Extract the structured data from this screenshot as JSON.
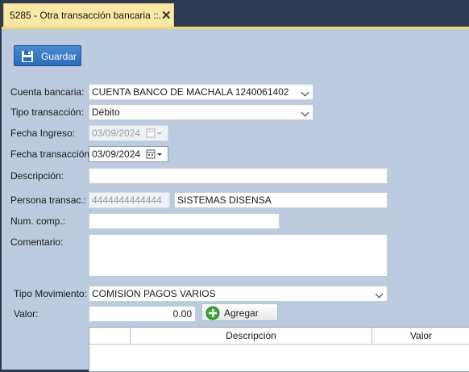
{
  "tab": {
    "title": "5285 - Otra transacción bancaria ::.",
    "close": "✕"
  },
  "toolbar": {
    "save_label": "Guardar"
  },
  "form": {
    "cuenta_bancaria": {
      "label": "Cuenta bancaria:",
      "value": "CUENTA BANCO DE MACHALA 1240061402"
    },
    "tipo_transaccion": {
      "label": "Tipo transacción:",
      "value": "Débito"
    },
    "fecha_ingreso": {
      "label": "Fecha Ingreso:",
      "value": "03/09/2024"
    },
    "fecha_transaccion": {
      "label": "Fecha transacción:",
      "value": "03/09/2024"
    },
    "descripcion": {
      "label": "Descripción:",
      "value": ""
    },
    "persona": {
      "label": "Persona transac.:",
      "id": "4444444444444",
      "name": "SISTEMAS DISENSA"
    },
    "num_comp": {
      "label": "Num. comp.:",
      "value": ""
    },
    "comentario": {
      "label": "Comentario:",
      "value": ""
    },
    "tipo_movimiento": {
      "label": "Tipo Movimiento:",
      "value": "COMISION PAGOS VARIOS"
    },
    "valor": {
      "label": "Valor:",
      "value": "0.00"
    }
  },
  "add_button": {
    "label": "Agregar"
  },
  "grid": {
    "columns": [
      "",
      "Descripción",
      "Valor"
    ]
  },
  "colors": {
    "panel": "#bccbe0",
    "tab": "#fbe8a7",
    "save_button": "#2a6cb7",
    "add_icon": "#3aa635"
  }
}
